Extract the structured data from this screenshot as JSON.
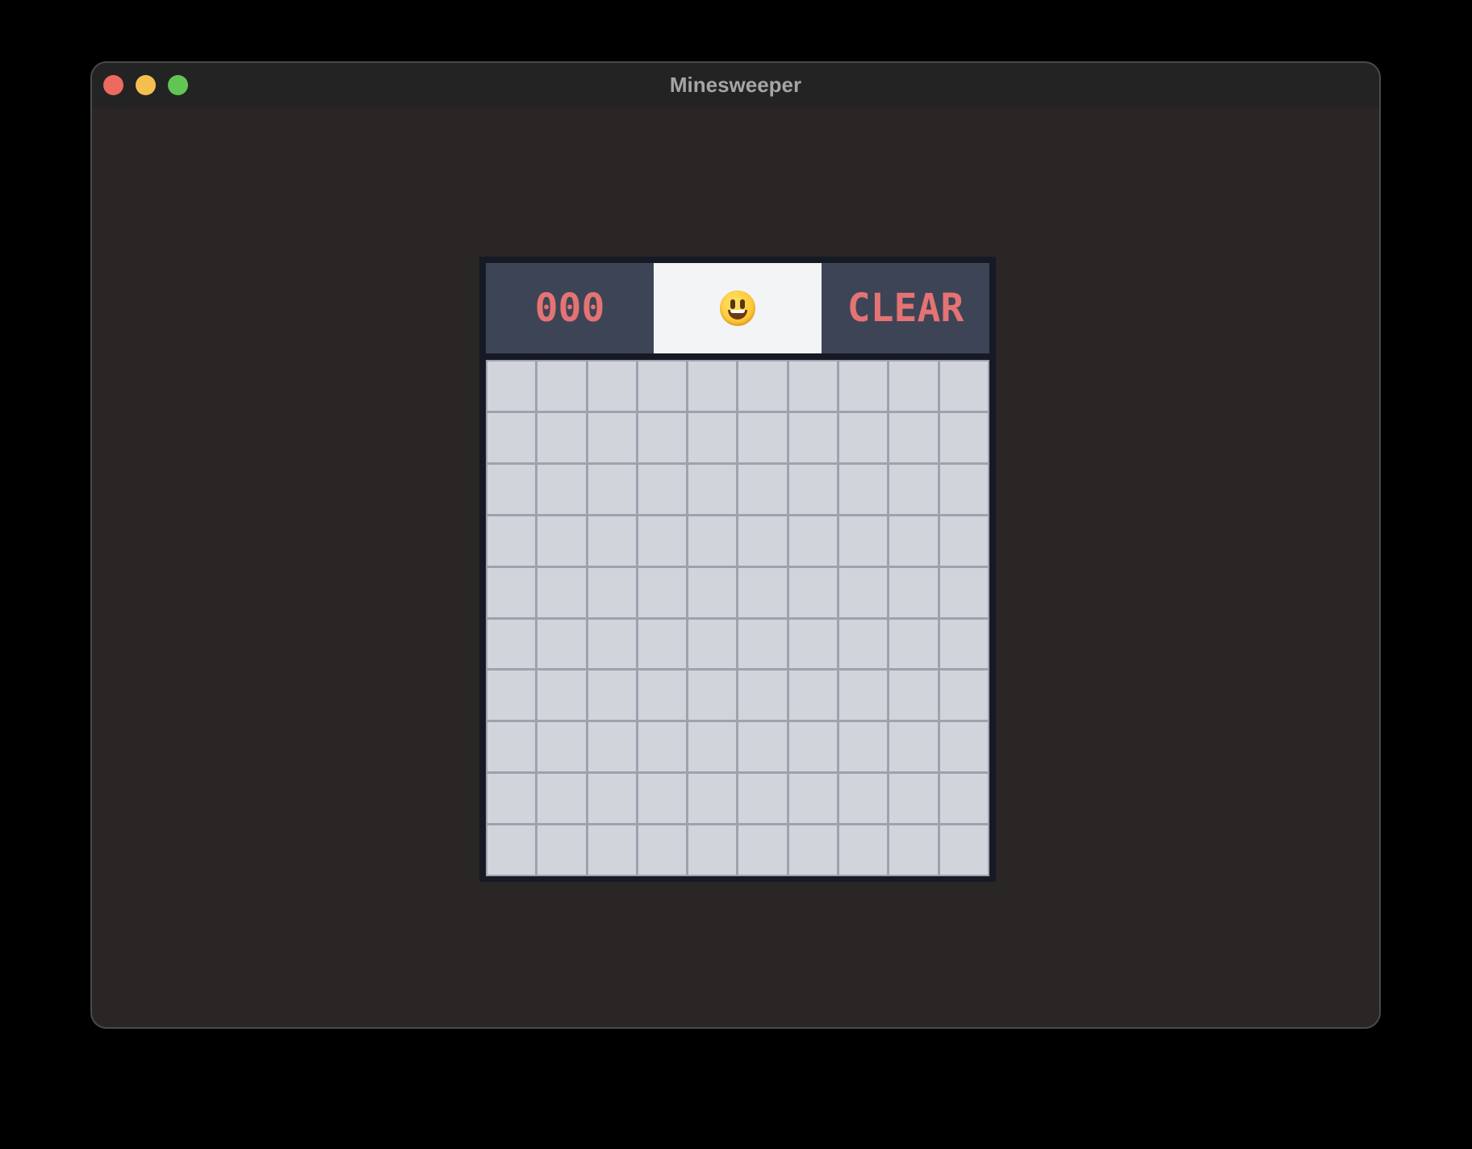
{
  "window": {
    "title": "Minesweeper"
  },
  "game": {
    "counter": "000",
    "face_icon": "smiley-face-icon",
    "status": "CLEAR",
    "rows": 10,
    "columns": 10
  },
  "colors": {
    "counter_text": "#e47373",
    "panel_bg": "#3d4455",
    "cell_bg": "#d1d5db",
    "grid_lines": "#9ca3af"
  }
}
